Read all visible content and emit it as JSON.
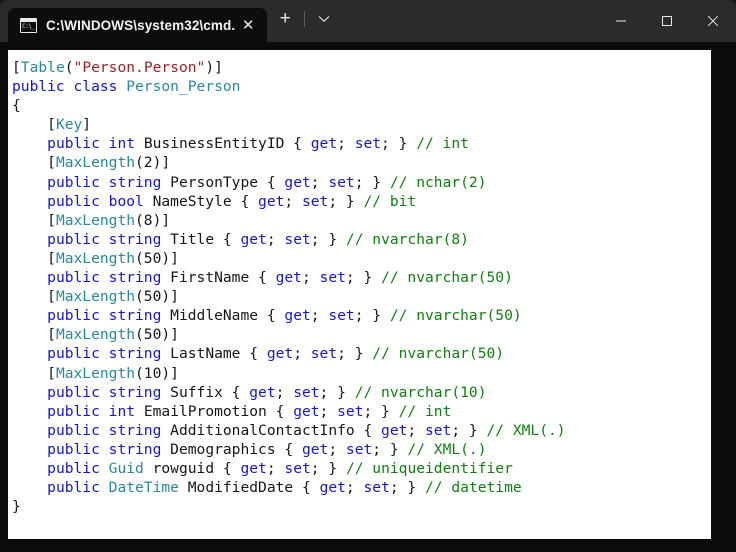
{
  "window": {
    "tab": {
      "icon": "cmd-console-icon",
      "title": "C:\\WINDOWS\\system32\\cmd.",
      "close_label": "✕"
    },
    "new_tab_label": "+",
    "dropdown_label": "∨",
    "controls": {
      "minimize_label": "—",
      "maximize_label": "□",
      "close_label": "✕"
    }
  },
  "colors": {
    "titlebar_bg": "#2b2b2b",
    "tab_bg": "#0d0d0d",
    "terminal_bg": "#ffffff",
    "window_bg": "#0b0b0b",
    "keyword": "#1414d6",
    "type": "#2a8a99",
    "string": "#9e2020",
    "comment": "#108010",
    "plain": "#161616"
  },
  "terminal": {
    "lines": [
      [
        {
          "t": "[",
          "c": "pl"
        },
        {
          "t": "Table",
          "c": "type"
        },
        {
          "t": "(",
          "c": "pl"
        },
        {
          "t": "\"Person.Person\"",
          "c": "str"
        },
        {
          "t": ")]",
          "c": "pl"
        }
      ],
      [
        {
          "t": "public class ",
          "c": "kw"
        },
        {
          "t": "Person_Person",
          "c": "type"
        }
      ],
      [
        {
          "t": "{",
          "c": "pl"
        }
      ],
      [
        {
          "t": "    [",
          "c": "pl"
        },
        {
          "t": "Key",
          "c": "type"
        },
        {
          "t": "]",
          "c": "pl"
        }
      ],
      [
        {
          "t": "    ",
          "c": "pl"
        },
        {
          "t": "public int ",
          "c": "kw"
        },
        {
          "t": "BusinessEntityID { ",
          "c": "pl"
        },
        {
          "t": "get",
          "c": "kw"
        },
        {
          "t": "; ",
          "c": "pl"
        },
        {
          "t": "set",
          "c": "kw"
        },
        {
          "t": "; } ",
          "c": "pl"
        },
        {
          "t": "// int",
          "c": "com"
        }
      ],
      [
        {
          "t": "    [",
          "c": "pl"
        },
        {
          "t": "MaxLength",
          "c": "type"
        },
        {
          "t": "(2)]",
          "c": "pl"
        }
      ],
      [
        {
          "t": "    ",
          "c": "pl"
        },
        {
          "t": "public string ",
          "c": "kw"
        },
        {
          "t": "PersonType { ",
          "c": "pl"
        },
        {
          "t": "get",
          "c": "kw"
        },
        {
          "t": "; ",
          "c": "pl"
        },
        {
          "t": "set",
          "c": "kw"
        },
        {
          "t": "; } ",
          "c": "pl"
        },
        {
          "t": "// nchar(2)",
          "c": "com"
        }
      ],
      [
        {
          "t": "    ",
          "c": "pl"
        },
        {
          "t": "public bool ",
          "c": "kw"
        },
        {
          "t": "NameStyle { ",
          "c": "pl"
        },
        {
          "t": "get",
          "c": "kw"
        },
        {
          "t": "; ",
          "c": "pl"
        },
        {
          "t": "set",
          "c": "kw"
        },
        {
          "t": "; } ",
          "c": "pl"
        },
        {
          "t": "// bit",
          "c": "com"
        }
      ],
      [
        {
          "t": "    [",
          "c": "pl"
        },
        {
          "t": "MaxLength",
          "c": "type"
        },
        {
          "t": "(8)]",
          "c": "pl"
        }
      ],
      [
        {
          "t": "    ",
          "c": "pl"
        },
        {
          "t": "public string ",
          "c": "kw"
        },
        {
          "t": "Title { ",
          "c": "pl"
        },
        {
          "t": "get",
          "c": "kw"
        },
        {
          "t": "; ",
          "c": "pl"
        },
        {
          "t": "set",
          "c": "kw"
        },
        {
          "t": "; } ",
          "c": "pl"
        },
        {
          "t": "// nvarchar(8)",
          "c": "com"
        }
      ],
      [
        {
          "t": "    [",
          "c": "pl"
        },
        {
          "t": "MaxLength",
          "c": "type"
        },
        {
          "t": "(50)]",
          "c": "pl"
        }
      ],
      [
        {
          "t": "    ",
          "c": "pl"
        },
        {
          "t": "public string ",
          "c": "kw"
        },
        {
          "t": "FirstName { ",
          "c": "pl"
        },
        {
          "t": "get",
          "c": "kw"
        },
        {
          "t": "; ",
          "c": "pl"
        },
        {
          "t": "set",
          "c": "kw"
        },
        {
          "t": "; } ",
          "c": "pl"
        },
        {
          "t": "// nvarchar(50)",
          "c": "com"
        }
      ],
      [
        {
          "t": "    [",
          "c": "pl"
        },
        {
          "t": "MaxLength",
          "c": "type"
        },
        {
          "t": "(50)]",
          "c": "pl"
        }
      ],
      [
        {
          "t": "    ",
          "c": "pl"
        },
        {
          "t": "public string ",
          "c": "kw"
        },
        {
          "t": "MiddleName { ",
          "c": "pl"
        },
        {
          "t": "get",
          "c": "kw"
        },
        {
          "t": "; ",
          "c": "pl"
        },
        {
          "t": "set",
          "c": "kw"
        },
        {
          "t": "; } ",
          "c": "pl"
        },
        {
          "t": "// nvarchar(50)",
          "c": "com"
        }
      ],
      [
        {
          "t": "    [",
          "c": "pl"
        },
        {
          "t": "MaxLength",
          "c": "type"
        },
        {
          "t": "(50)]",
          "c": "pl"
        }
      ],
      [
        {
          "t": "    ",
          "c": "pl"
        },
        {
          "t": "public string ",
          "c": "kw"
        },
        {
          "t": "LastName { ",
          "c": "pl"
        },
        {
          "t": "get",
          "c": "kw"
        },
        {
          "t": "; ",
          "c": "pl"
        },
        {
          "t": "set",
          "c": "kw"
        },
        {
          "t": "; } ",
          "c": "pl"
        },
        {
          "t": "// nvarchar(50)",
          "c": "com"
        }
      ],
      [
        {
          "t": "    [",
          "c": "pl"
        },
        {
          "t": "MaxLength",
          "c": "type"
        },
        {
          "t": "(10)]",
          "c": "pl"
        }
      ],
      [
        {
          "t": "    ",
          "c": "pl"
        },
        {
          "t": "public string ",
          "c": "kw"
        },
        {
          "t": "Suffix { ",
          "c": "pl"
        },
        {
          "t": "get",
          "c": "kw"
        },
        {
          "t": "; ",
          "c": "pl"
        },
        {
          "t": "set",
          "c": "kw"
        },
        {
          "t": "; } ",
          "c": "pl"
        },
        {
          "t": "// nvarchar(10)",
          "c": "com"
        }
      ],
      [
        {
          "t": "    ",
          "c": "pl"
        },
        {
          "t": "public int ",
          "c": "kw"
        },
        {
          "t": "EmailPromotion { ",
          "c": "pl"
        },
        {
          "t": "get",
          "c": "kw"
        },
        {
          "t": "; ",
          "c": "pl"
        },
        {
          "t": "set",
          "c": "kw"
        },
        {
          "t": "; } ",
          "c": "pl"
        },
        {
          "t": "// int",
          "c": "com"
        }
      ],
      [
        {
          "t": "    ",
          "c": "pl"
        },
        {
          "t": "public string ",
          "c": "kw"
        },
        {
          "t": "AdditionalContactInfo { ",
          "c": "pl"
        },
        {
          "t": "get",
          "c": "kw"
        },
        {
          "t": "; ",
          "c": "pl"
        },
        {
          "t": "set",
          "c": "kw"
        },
        {
          "t": "; } ",
          "c": "pl"
        },
        {
          "t": "// XML(.)",
          "c": "com"
        }
      ],
      [
        {
          "t": "    ",
          "c": "pl"
        },
        {
          "t": "public string ",
          "c": "kw"
        },
        {
          "t": "Demographics { ",
          "c": "pl"
        },
        {
          "t": "get",
          "c": "kw"
        },
        {
          "t": "; ",
          "c": "pl"
        },
        {
          "t": "set",
          "c": "kw"
        },
        {
          "t": "; } ",
          "c": "pl"
        },
        {
          "t": "// XML(.)",
          "c": "com"
        }
      ],
      [
        {
          "t": "    ",
          "c": "pl"
        },
        {
          "t": "public ",
          "c": "kw"
        },
        {
          "t": "Guid",
          "c": "type"
        },
        {
          "t": " rowguid { ",
          "c": "pl"
        },
        {
          "t": "get",
          "c": "kw"
        },
        {
          "t": "; ",
          "c": "pl"
        },
        {
          "t": "set",
          "c": "kw"
        },
        {
          "t": "; } ",
          "c": "pl"
        },
        {
          "t": "// uniqueidentifier",
          "c": "com"
        }
      ],
      [
        {
          "t": "    ",
          "c": "pl"
        },
        {
          "t": "public ",
          "c": "kw"
        },
        {
          "t": "DateTime",
          "c": "type"
        },
        {
          "t": " ModifiedDate { ",
          "c": "pl"
        },
        {
          "t": "get",
          "c": "kw"
        },
        {
          "t": "; ",
          "c": "pl"
        },
        {
          "t": "set",
          "c": "kw"
        },
        {
          "t": "; } ",
          "c": "pl"
        },
        {
          "t": "// datetime",
          "c": "com"
        }
      ],
      [
        {
          "t": "}",
          "c": "pl"
        }
      ]
    ]
  }
}
